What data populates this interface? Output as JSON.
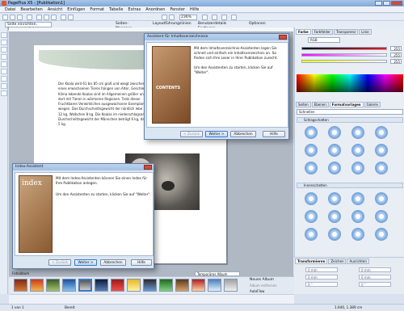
{
  "window": {
    "title": "PagePlus X5 - [Publikation1]"
  },
  "menu": [
    "Datei",
    "Bearbeiten",
    "Ansicht",
    "Einfügen",
    "Format",
    "Tabelle",
    "Extras",
    "Anordnen",
    "Fenster",
    "Hilfe"
  ],
  "toolbar2": {
    "context": "Seite einrichten, Benutzerdefiniert",
    "pages_manager": "Seiten-Manager",
    "layout": "Layoutführungslinien",
    "publication_settings": "Benutzerdetails Festlegen",
    "options": "Optionen"
  },
  "toolbar1": {
    "zoom": "236%"
  },
  "page_text": {
    "lines": [
      "Der Koala wird 61 bis 85 cm groß und wiegt zwischen",
      "eines erwachsenen Tieres hängen von Alter, Geschle",
      "Klima lebende Koalas sind im Allgemeinen größer un",
      "dort mit Tieren in wärmeren Regionen. Trotz dieser",
      "Fruchtbaren Verwirklichen ausgewachsene Exemplare",
      "wiegen. Das Durchschnittsgewicht der nördlich lebe",
      "12 kg, Weibchen 8 kg. Die Koalas im niederschlagsarm",
      "Durchschnittsgewicht der Männchen beträgt 6 kg, das der Weibchen 5 kg."
    ]
  },
  "dialog_text": {
    "title": "Assistent für Inhaltsverzeichnisse",
    "body1": "Mit dem Inhaltsverzeichnis-Assistenten legen Sie schnell und einfach ein Inhaltsverzeichnis an. So finden sich Ihre Leser in Ihrer Publikation zurecht.",
    "body2": "Um den Assistenten zu starten, klicken Sie auf \"Weiter\".",
    "image_label": "CONTENTS",
    "back": "< Zurück",
    "next": "Weiter >",
    "cancel": "Abbrechen",
    "help": "Hilfe"
  },
  "dialog_index": {
    "title": "Index-Assistent",
    "body1": "Mit dem Index-Assistenten können Sie einen Index für Ihre Publikation anlegen.",
    "body2": "Um den Assistenten zu starten, klicken Sie auf \"Weiter\".",
    "image_label": "index",
    "back": "< Zurück",
    "next": "Weiter >",
    "cancel": "Abbrechen",
    "help": "Hilfe"
  },
  "right_panel": {
    "tabs_top": [
      "Farbe",
      "Farbfelder",
      "Transparenz",
      "Linie"
    ],
    "color_model": "RGB",
    "rgb": [
      "255",
      "255",
      "255"
    ],
    "tabs_mid": [
      "Seiten",
      "Ebenen",
      "Formatvorlagen",
      "Galerie"
    ],
    "dropdown": "Schnellen",
    "section1": "Schlagschatten",
    "section2": "Innenschatten",
    "transform_tabs": [
      "Transformieren",
      "Zeichen",
      "Ausrichten"
    ],
    "transform_fields": [
      "0 mm",
      "0 mm",
      "0 mm",
      "0 mm",
      "0 °",
      "0 °"
    ]
  },
  "gallery": {
    "label": "Fotoalbum",
    "album_select": "Temporäres Album",
    "new_album": "Neues Album",
    "remove_album": "Album entfernen",
    "autoflow": "AutoFlow"
  },
  "status": {
    "page": "1 von 1",
    "mode": "Bereit",
    "coords": "1.640, 1.389 cm"
  }
}
